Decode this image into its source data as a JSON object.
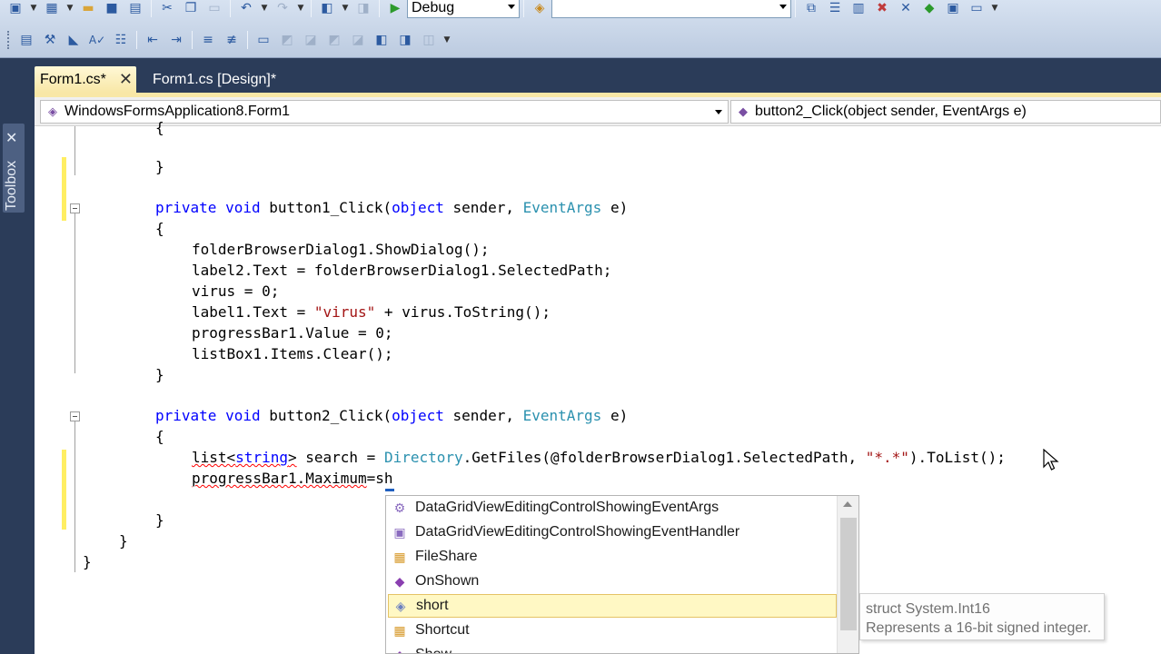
{
  "toolbar": {
    "config_value": "Debug",
    "platform_value": ""
  },
  "toolbox": {
    "label": "Toolbox"
  },
  "tabs": [
    {
      "label": "Form1.cs*",
      "active": true
    },
    {
      "label": "Form1.cs [Design]*",
      "active": false
    }
  ],
  "navbar": {
    "class_value": "WindowsFormsApplication8.Form1",
    "member_value": "button2_Click(object sender, EventArgs e)"
  },
  "code": {
    "line0": "{",
    "line1": "}",
    "line2_pre": "private",
    "line2_void": "void",
    "line2_name": " button1_Click(",
    "line2_obj": "object",
    "line2_mid": " sender, ",
    "line2_type": "EventArgs",
    "line2_end": " e)",
    "line3": "{",
    "line4": "folderBrowserDialog1.ShowDialog();",
    "line5": "label2.Text = folderBrowserDialog1.SelectedPath;",
    "line6": "virus = 0;",
    "line7_a": "label1.Text = ",
    "line7_str": "\"virus\"",
    "line7_b": " + virus.ToString();",
    "line8": "progressBar1.Value = 0;",
    "line9": "listBox1.Items.Clear();",
    "line10": "}",
    "line11_pre": "private",
    "line11_void": "void",
    "line11_name": " button2_Click(",
    "line11_obj": "object",
    "line11_mid": " sender, ",
    "line11_type": "EventArgs",
    "line11_end": " e)",
    "line12": "{",
    "line13_a": "list<",
    "line13_kw": "string",
    "line13_b": ">",
    "line13_c": " search = ",
    "line13_type": "Directory",
    "line13_d": ".GetFiles(@folderBrowserDialog1.SelectedPath, ",
    "line13_str": "\"*.*\"",
    "line13_e": ").ToList();",
    "line14_a": "progressBar1.Maximum",
    "line14_b": "=sh",
    "line15": "}",
    "line16": "}",
    "line17": "}"
  },
  "intellisense": {
    "items": [
      {
        "label": "DataGridViewEditingControlShowingEventArgs",
        "icon": "class-icon"
      },
      {
        "label": "DataGridViewEditingControlShowingEventHandler",
        "icon": "delegate-icon"
      },
      {
        "label": "FileShare",
        "icon": "enum-icon"
      },
      {
        "label": "OnShown",
        "icon": "method-icon"
      },
      {
        "label": "short",
        "icon": "struct-icon"
      },
      {
        "label": "Shortcut",
        "icon": "enum-icon"
      },
      {
        "label": "Show",
        "icon": "method-icon"
      }
    ],
    "selected_index": 4
  },
  "tooltip": {
    "line1": "struct System.Int16",
    "line2": "Represents a 16-bit signed integer."
  },
  "colors": {
    "keyword": "#0000ff",
    "type": "#2b91af",
    "string": "#a31515",
    "ide_background": "#2b3c59",
    "active_tab": "#f8e7a6",
    "change_margin": "#ffee62"
  }
}
